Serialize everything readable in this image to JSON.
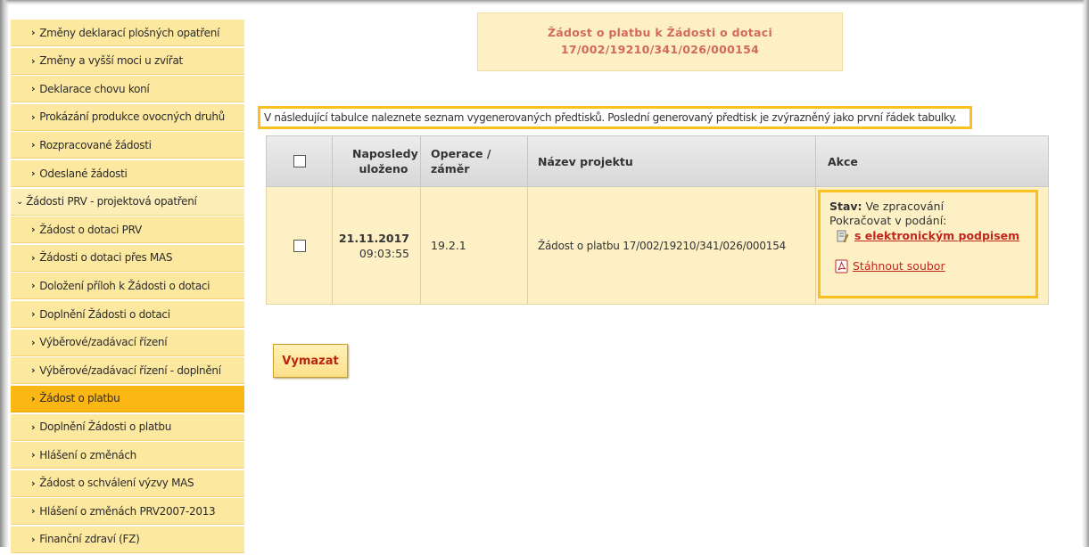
{
  "sidebar": {
    "items": [
      {
        "label": "Změny deklarací plošných opatření",
        "type": "sub"
      },
      {
        "label": "Změny a vyšší moci u zvířat",
        "type": "sub"
      },
      {
        "label": "Deklarace chovu koní",
        "type": "sub"
      },
      {
        "label": "Prokázání produkce ovocných druhů",
        "type": "sub"
      },
      {
        "label": "Rozpracované žádosti",
        "type": "sub"
      },
      {
        "label": "Odeslané žádosti",
        "type": "sub"
      },
      {
        "label": "Žádosti PRV - projektová opatření",
        "type": "group"
      },
      {
        "label": "Žádost o dotaci PRV",
        "type": "sub"
      },
      {
        "label": "Žádosti o dotaci přes MAS",
        "type": "sub"
      },
      {
        "label": "Doložení příloh k Žádosti o dotaci",
        "type": "sub"
      },
      {
        "label": "Doplnění Žádosti o dotaci",
        "type": "sub"
      },
      {
        "label": "Výběrové/zadávací řízení",
        "type": "sub"
      },
      {
        "label": "Výběrové/zadávací řízení - doplnění",
        "type": "sub"
      },
      {
        "label": "Žádost o platbu",
        "type": "sub",
        "active": true
      },
      {
        "label": "Doplnění Žádosti o platbu",
        "type": "sub"
      },
      {
        "label": "Hlášení o změnách",
        "type": "sub"
      },
      {
        "label": "Žádost o schválení výzvy MAS",
        "type": "sub"
      },
      {
        "label": "Hlášení o změnách PRV2007-2013",
        "type": "sub"
      },
      {
        "label": "Finanční zdraví (FZ)",
        "type": "sub"
      }
    ]
  },
  "header": {
    "title_line1": "Žádost o platbu k Žádosti o dotaci",
    "title_line2": "17/002/19210/341/026/000154"
  },
  "info": "V následující tabulce naleznete seznam vygenerovaných předtisků. Poslední generovaný předtisk je zvýrazněný jako první řádek tabulky.",
  "table": {
    "headers": {
      "saved": "Naposledy uloženo",
      "operation": "Operace / záměr",
      "project": "Název projektu",
      "actions": "Akce"
    },
    "row": {
      "date": "21.11.2017",
      "time": "09:03:55",
      "operation": "19.2.1",
      "project": "Žádost o platbu 17/002/19210/341/026/000154",
      "status_label": "Stav:",
      "status_value": "Ve zpracování",
      "continue_label": "Pokračovat v podání:",
      "sign_link": "s elektronickým podpisem",
      "download_link": "Stáhnout soubor"
    }
  },
  "buttons": {
    "delete": "Vymazat"
  },
  "colors": {
    "accent": "#fbc01d",
    "active_nav": "#fdb714",
    "nav_bg": "#fde8a0",
    "title_text": "#d26a5a",
    "link_red": "#c0281e"
  }
}
